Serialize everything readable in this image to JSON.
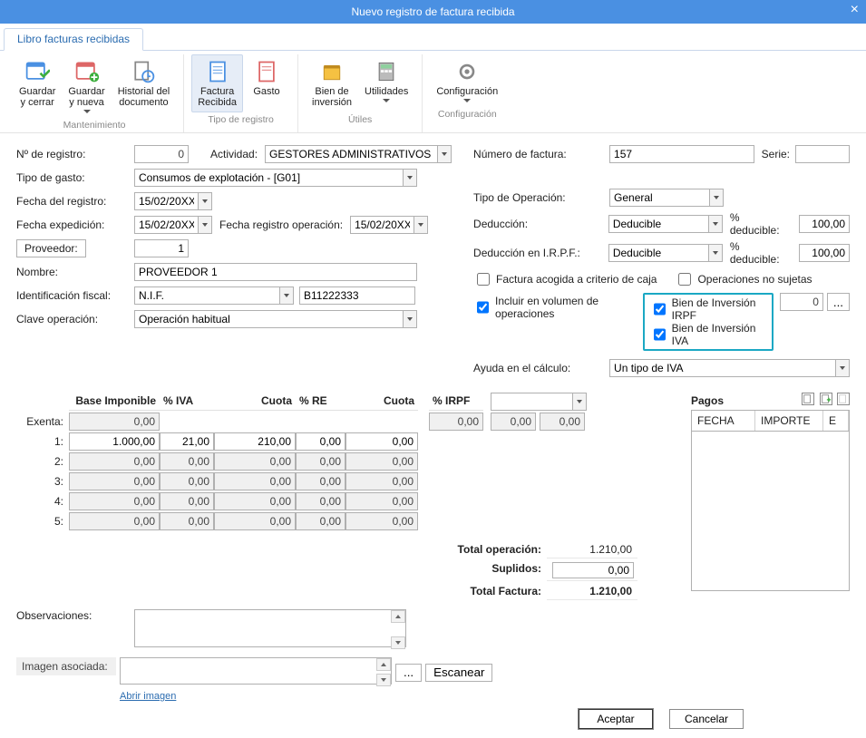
{
  "window": {
    "title": "Nuevo registro de factura recibida",
    "close": "×"
  },
  "tab": {
    "label": "Libro facturas recibidas"
  },
  "ribbon": {
    "maint": {
      "save_close_l1": "Guardar",
      "save_close_l2": "y cerrar",
      "save_new_l1": "Guardar",
      "save_new_l2": "y nueva",
      "save_new_arrow": "▾",
      "hist_l1": "Historial del",
      "hist_l2": "documento",
      "group_label": "Mantenimiento"
    },
    "tipo": {
      "factura_l1": "Factura",
      "factura_l2": "Recibida",
      "gasto_l1": "Gasto",
      "group_label": "Tipo de registro"
    },
    "utiles": {
      "bien_l1": "Bien de",
      "bien_l2": "inversión",
      "util_l1": "Utilidades",
      "util_arrow": "▾",
      "group_label": "Útiles"
    },
    "config": {
      "cfg_l1": "Configuración",
      "group_label": "Configuración"
    }
  },
  "left": {
    "nregistro_lbl": "Nº de registro:",
    "nregistro_val": "0",
    "actividad_lbl": "Actividad:",
    "actividad_val": "GESTORES ADMINISTRATIVOS",
    "tipo_gasto_lbl": "Tipo de gasto:",
    "tipo_gasto_val": "Consumos de explotación - [G01]",
    "fecha_reg_lbl": "Fecha del registro:",
    "fecha_reg_val": "15/02/20XX",
    "fecha_exp_lbl": "Fecha expedición:",
    "fecha_exp_val": "15/02/20XX",
    "fecha_op_lbl": "Fecha registro operación:",
    "fecha_op_val": "15/02/20XX",
    "proveedor_btn": "Proveedor:",
    "proveedor_val": "1",
    "nombre_lbl": "Nombre:",
    "nombre_val": "PROVEEDOR 1",
    "id_fiscal_lbl": "Identificación fiscal:",
    "id_fiscal_type": "N.I.F.",
    "id_fiscal_val": "B11222333",
    "clave_op_lbl": "Clave operación:",
    "clave_op_val": "Operación habitual"
  },
  "right": {
    "num_factura_lbl": "Número de factura:",
    "num_factura_val": "157",
    "serie_lbl": "Serie:",
    "serie_val": "",
    "tipo_op_lbl": "Tipo de Operación:",
    "tipo_op_val": "General",
    "deduccion_lbl": "Deducción:",
    "deduccion_val": "Deducible",
    "pct_ded_lbl": "% deducible:",
    "pct_ded_val": "100,00",
    "ded_irpf_lbl": "Deducción en I.R.P.F.:",
    "ded_irpf_val": "Deducible",
    "pct_ded2_lbl": "% deducible:",
    "pct_ded2_val": "100,00",
    "chk_caja": "Factura acogida a criterio de caja",
    "chk_no_sujetas": "Operaciones no sujetas",
    "chk_volumen": "Incluir en  volumen de operaciones",
    "chk_bien_irpf": "Bien de Inversión IRPF",
    "chk_bien_iva": "Bien de Inversión IVA",
    "bien_count": "0",
    "bien_btn": "...",
    "ayuda_lbl": "Ayuda en el cálculo:",
    "ayuda_val": "Un tipo de IVA"
  },
  "grid": {
    "h_base": "Base Imponible",
    "h_iva": "% IVA",
    "h_cuota": "Cuota",
    "h_re": "% RE",
    "h_cuota2": "Cuota",
    "h_irpf": "% IRPF",
    "exenta_lbl": "Exenta:",
    "row_lbls": [
      "1:",
      "2:",
      "3:",
      "4:",
      "5:"
    ],
    "exenta": {
      "base": "0,00"
    },
    "rows": [
      {
        "base": "1.000,00",
        "iva": "21,00",
        "cuota": "210,00",
        "re": "0,00",
        "cuota2": "0,00"
      },
      {
        "base": "0,00",
        "iva": "0,00",
        "cuota": "0,00",
        "re": "0,00",
        "cuota2": "0,00"
      },
      {
        "base": "0,00",
        "iva": "0,00",
        "cuota": "0,00",
        "re": "0,00",
        "cuota2": "0,00"
      },
      {
        "base": "0,00",
        "iva": "0,00",
        "cuota": "0,00",
        "re": "0,00",
        "cuota2": "0,00"
      },
      {
        "base": "0,00",
        "iva": "0,00",
        "cuota": "0,00",
        "re": "0,00",
        "cuota2": "0,00"
      }
    ],
    "irpf_pct": "",
    "irpf_vals": [
      "0,00",
      "0,00",
      "0,00"
    ],
    "tot_op_lbl": "Total operación:",
    "tot_op_val": "1.210,00",
    "suplidos_lbl": "Suplidos:",
    "suplidos_val": "0,00",
    "tot_fact_lbl": "Total Factura:",
    "tot_fact_val": "1.210,00"
  },
  "obs": {
    "lbl": "Observaciones:",
    "val": ""
  },
  "img": {
    "lbl": "Imagen asociada:",
    "val": "",
    "browse": "...",
    "scan": "Escanear",
    "open": "Abrir imagen"
  },
  "pagos": {
    "title": "Pagos",
    "col_fecha": "FECHA",
    "col_importe": "IMPORTE",
    "col_e": "E"
  },
  "buttons": {
    "ok": "Aceptar",
    "cancel": "Cancelar"
  }
}
